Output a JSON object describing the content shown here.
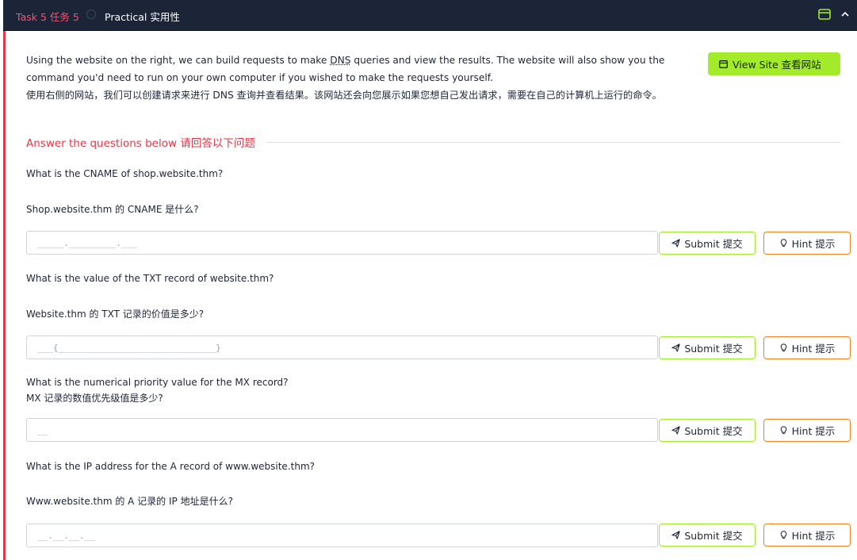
{
  "header": {
    "task_label": "Task 5  任务 5",
    "title": "Practical  实用性",
    "site_icon": "browser-window-icon",
    "collapse_icon": "chevron-up-icon",
    "colors": {
      "bg": "#1c2538",
      "task": "#ff4d6d",
      "site_icon": "#a3ea2a"
    }
  },
  "description": {
    "en_before": "Using the website on the right, we can build requests to make ",
    "en_abbr": "DNS",
    "en_after": " queries and view the results. The website will also show you the command you'd need to run on your own computer if you wished to make the requests yourself.",
    "zh": "使用右侧的网站，我们可以创建请求来进行 DNS 查询并查看结果。该网站还会向您展示如果您想自己发出请求，需要在自己的计算机上运行的命令。"
  },
  "view_site": {
    "label": "View Site   查看网站",
    "icon": "browser-window-icon",
    "color": "#a3ea2a"
  },
  "section": {
    "label": "Answer the questions below   请回答以下问题",
    "color": "#e03a4a"
  },
  "questions": [
    {
      "en": "What is the CNAME of shop.website.thm?",
      "zh": "Shop.website.thm 的 CNAME 是什么?",
      "placeholder": "_____._________.___",
      "submit": "Submit  提交",
      "hint": "Hint   提示"
    },
    {
      "en": "What is the value of the TXT record of website.thm?",
      "zh": "Website.thm 的 TXT 记录的价值是多少?",
      "placeholder": "___{______________________________}",
      "submit": "Submit  提交",
      "hint": "Hint   提示"
    },
    {
      "en": "What is the numerical priority value for the MX record?",
      "zh": "MX 记录的数值优先级值是多少?",
      "placeholder": "__",
      "submit": "Submit  提交",
      "hint": "Hint   提示"
    },
    {
      "en": "What is the IP address for the A record of www.website.thm?",
      "zh": "Www.website.thm 的 A 记录的 IP 地址是什么?",
      "placeholder": "__.__.__.__",
      "submit": "Submit  提交",
      "hint": "Hint   提示"
    }
  ],
  "icons": {
    "submit": "send-icon",
    "hint": "lightbulb-icon"
  },
  "colors": {
    "accent": "#e03a4a",
    "submit_border": "#a3ea2a",
    "hint_border": "#f0821e"
  }
}
